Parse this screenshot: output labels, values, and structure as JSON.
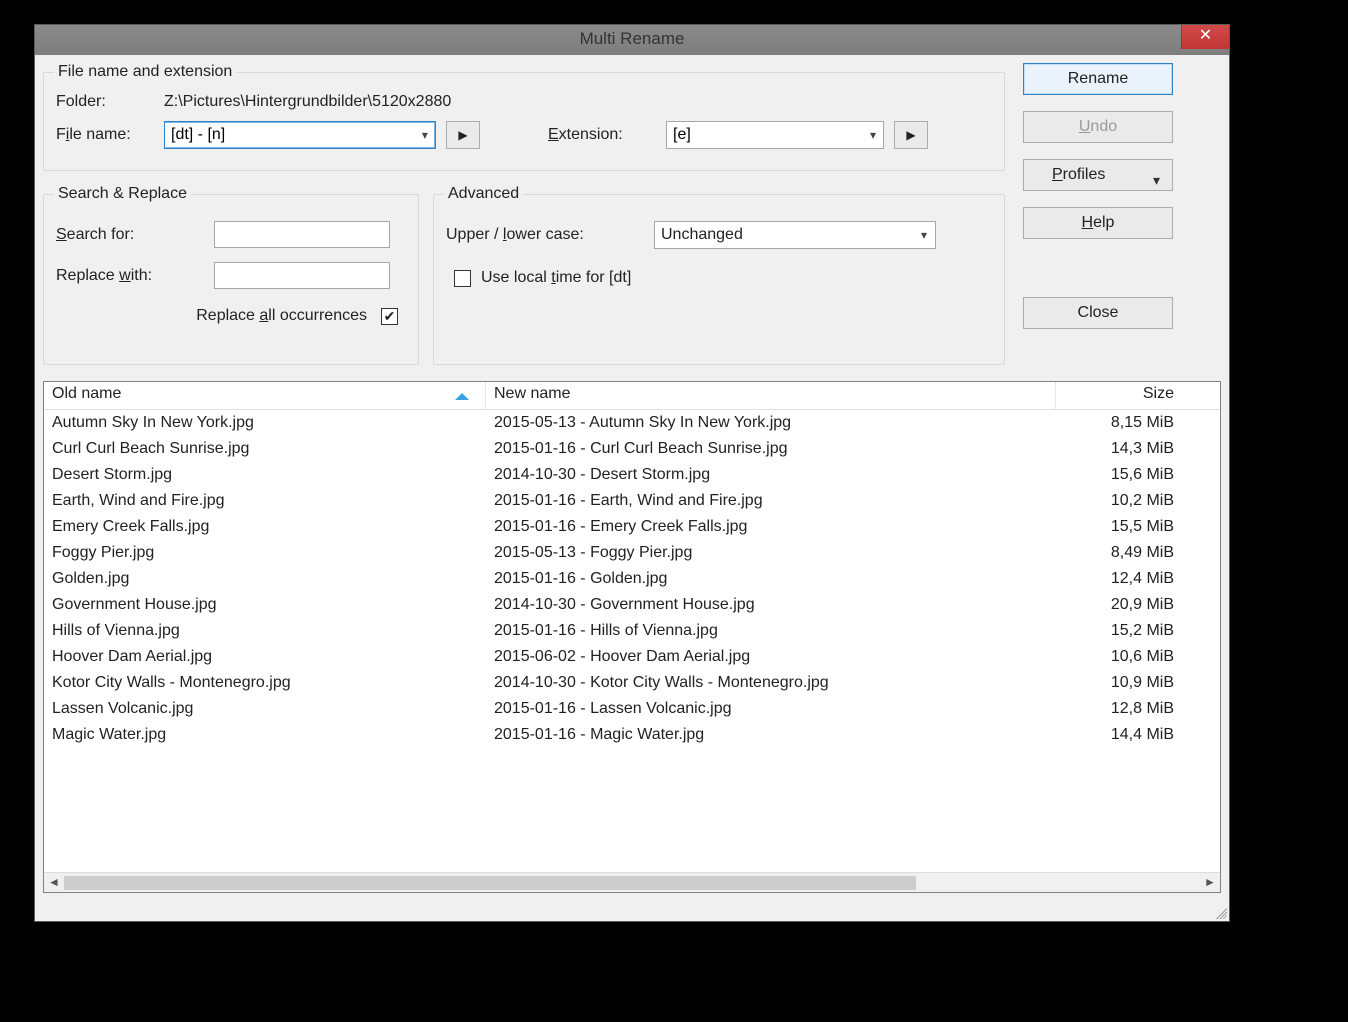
{
  "window": {
    "title": "Multi Rename"
  },
  "groups": {
    "file_ext": "File name and extension",
    "search_replace": "Search & Replace",
    "advanced": "Advanced"
  },
  "file": {
    "folder_label": "Folder:",
    "folder_value": "Z:\\Pictures\\Hintergrundbilder\\5120x2880",
    "name_label_pre": "F",
    "name_label_in": "i",
    "name_label_post": "le name:",
    "name_value": "[dt] - [n]",
    "ext_label_pre": "",
    "ext_label_in": "E",
    "ext_label_post": "xtension:",
    "ext_value": "[e]"
  },
  "search": {
    "search_label_pre": "",
    "search_label_in": "S",
    "search_label_post": "earch for:",
    "search_value": "",
    "replace_label_pre": "Replace ",
    "replace_label_in": "w",
    "replace_label_post": "ith:",
    "replace_value": "",
    "replace_all_pre": "Replace ",
    "replace_all_in": "a",
    "replace_all_post": "ll occurrences",
    "replace_all_checked": true
  },
  "advanced": {
    "case_label_pre": "Upper / ",
    "case_label_in": "l",
    "case_label_post": "ower case:",
    "case_value": "Unchanged",
    "local_time_pre": "Use local ",
    "local_time_in": "t",
    "local_time_post": "ime for [dt]",
    "local_time_checked": false
  },
  "buttons": {
    "rename": "Rename",
    "undo_in": "U",
    "undo_post": "ndo",
    "profiles_in": "P",
    "profiles_post": "rofiles",
    "help_in": "H",
    "help_post": "elp",
    "close": "Close"
  },
  "columns": {
    "old": "Old name",
    "new": "New name",
    "size": "Size"
  },
  "rows": [
    {
      "old": "Autumn Sky In New York.jpg",
      "new": "2015-05-13 - Autumn Sky In New York.jpg",
      "size": "8,15 MiB"
    },
    {
      "old": "Curl Curl Beach Sunrise.jpg",
      "new": "2015-01-16 - Curl Curl Beach Sunrise.jpg",
      "size": "14,3 MiB"
    },
    {
      "old": "Desert Storm.jpg",
      "new": "2014-10-30 - Desert Storm.jpg",
      "size": "15,6 MiB"
    },
    {
      "old": "Earth, Wind and Fire.jpg",
      "new": "2015-01-16 - Earth, Wind and Fire.jpg",
      "size": "10,2 MiB"
    },
    {
      "old": "Emery Creek Falls.jpg",
      "new": "2015-01-16 - Emery Creek Falls.jpg",
      "size": "15,5 MiB"
    },
    {
      "old": "Foggy Pier.jpg",
      "new": "2015-05-13 - Foggy Pier.jpg",
      "size": "8,49 MiB"
    },
    {
      "old": "Golden.jpg",
      "new": "2015-01-16 - Golden.jpg",
      "size": "12,4 MiB"
    },
    {
      "old": "Government House.jpg",
      "new": "2014-10-30 - Government House.jpg",
      "size": "20,9 MiB"
    },
    {
      "old": "Hills of Vienna.jpg",
      "new": "2015-01-16 - Hills of Vienna.jpg",
      "size": "15,2 MiB"
    },
    {
      "old": "Hoover Dam Aerial.jpg",
      "new": "2015-06-02 - Hoover Dam Aerial.jpg",
      "size": "10,6 MiB"
    },
    {
      "old": "Kotor City Walls - Montenegro.jpg",
      "new": "2014-10-30 - Kotor City Walls - Montenegro.jpg",
      "size": "10,9 MiB"
    },
    {
      "old": "Lassen Volcanic.jpg",
      "new": "2015-01-16 - Lassen Volcanic.jpg",
      "size": "12,8 MiB"
    },
    {
      "old": "Magic Water.jpg",
      "new": "2015-01-16 - Magic Water.jpg",
      "size": "14,4 MiB"
    }
  ]
}
